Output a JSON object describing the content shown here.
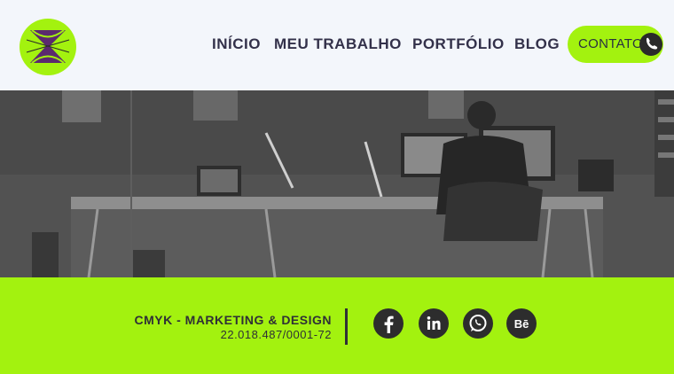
{
  "nav": {
    "items": [
      {
        "label": "INÍCIO"
      },
      {
        "label": "MEU TRABALHO"
      },
      {
        "label": "PORTFÓLIO"
      },
      {
        "label": "BLOG"
      }
    ],
    "contact_label": "CONTATO"
  },
  "footer": {
    "company": "CMYK - MARKETING & DESIGN",
    "cnpj": "22.018.487/0001-72",
    "social": [
      {
        "icon": "facebook-icon"
      },
      {
        "icon": "linkedin-icon"
      },
      {
        "icon": "whatsapp-icon"
      },
      {
        "icon": "behance-icon"
      }
    ]
  },
  "colors": {
    "accent": "#a3f20f",
    "header_bg": "#f3f6fb",
    "text_dark": "#33314a",
    "logo_purple": "#5b2a6e"
  }
}
